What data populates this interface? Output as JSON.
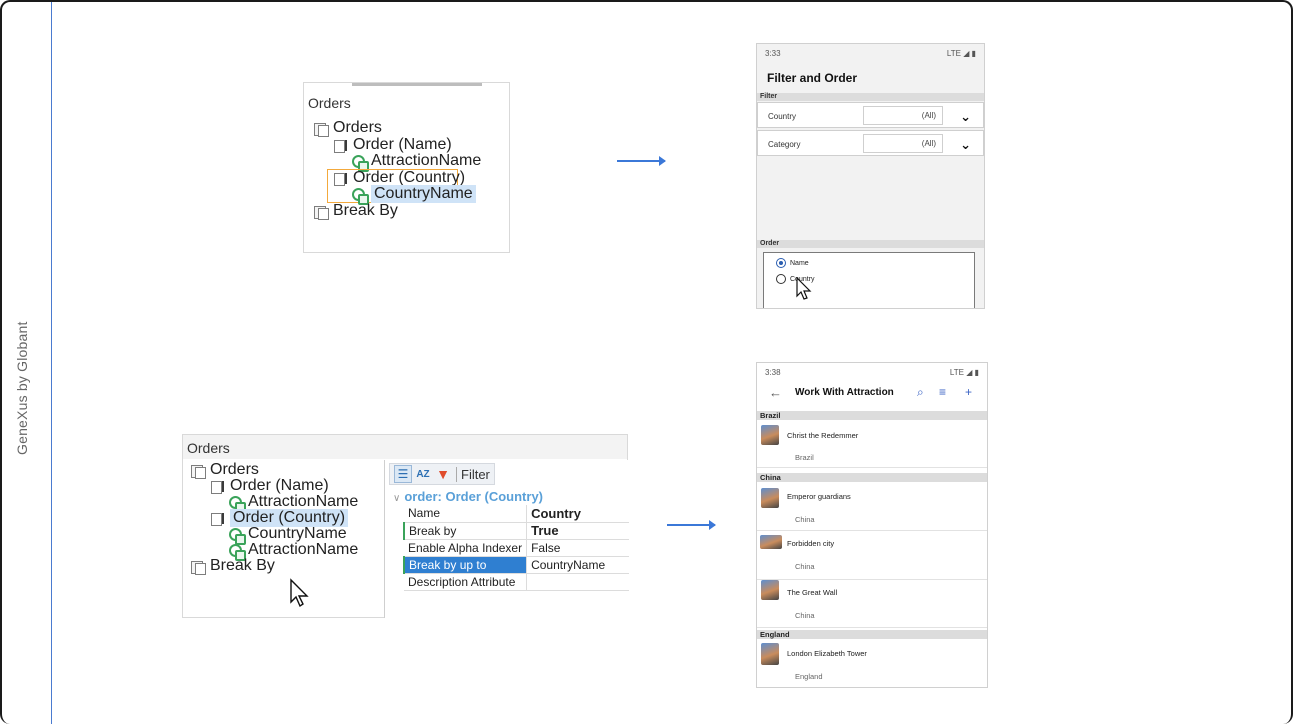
{
  "brand": "GeneXus by Globant",
  "top_tree": {
    "title": "Orders",
    "items": [
      "Orders",
      "Order (Name)",
      "AttractionName",
      "Order (Country)",
      "CountryName",
      "Break By"
    ]
  },
  "bottom_tree": {
    "title": "Orders",
    "items": [
      "Orders",
      "Order (Name)",
      "AttractionName",
      "Order (Country)",
      "CountryName",
      "AttractionName",
      "Break By"
    ]
  },
  "properties": {
    "toolbar_filter": "Filter",
    "header": "order: Order (Country)",
    "rows": [
      {
        "key": "Name",
        "value": "Country"
      },
      {
        "key": "Break by",
        "value": "True"
      },
      {
        "key": "Enable Alpha Indexer",
        "value": "False"
      },
      {
        "key": "Break by up to",
        "value": "CountryName"
      },
      {
        "key": "Description Attribute",
        "value": ""
      }
    ]
  },
  "phone_filter": {
    "time": "3:33",
    "status": "LTE ◢ ▮",
    "title": "Filter and Order",
    "filter_section": "Filter",
    "filters": [
      {
        "label": "Country",
        "value": "(All)"
      },
      {
        "label": "Category",
        "value": "(All)"
      }
    ],
    "order_section": "Order",
    "order_options": [
      "Name",
      "Country"
    ]
  },
  "phone_list": {
    "time": "3:38",
    "status": "LTE ◢ ▮",
    "back": "←",
    "title": "Work With Attraction",
    "actions": [
      "search-icon",
      "filter-icon",
      "add-icon"
    ],
    "groups": [
      {
        "name": "Brazil",
        "items": [
          {
            "name": "Christ the Redemmer",
            "country": "Brazil"
          }
        ]
      },
      {
        "name": "China",
        "items": [
          {
            "name": "Emperor guardians",
            "country": "China"
          },
          {
            "name": "Forbidden city",
            "country": "China"
          },
          {
            "name": "The Great Wall",
            "country": "China"
          }
        ]
      },
      {
        "name": "England",
        "items": [
          {
            "name": "London Elizabeth Tower",
            "country": "England"
          }
        ]
      }
    ]
  },
  "colors": {
    "accent": "#3b78d8",
    "selection": "#2f7fd1",
    "highlight_border": "#f3a93c"
  }
}
